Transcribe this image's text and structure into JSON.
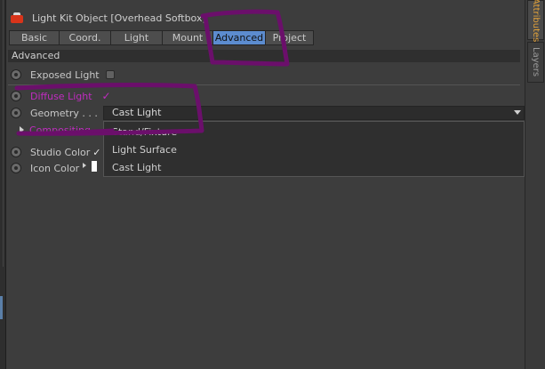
{
  "window": {
    "title": "Light Kit Object [Overhead Softbox]"
  },
  "tabs": [
    {
      "label": "Basic"
    },
    {
      "label": "Coord."
    },
    {
      "label": "Light"
    },
    {
      "label": "Mount"
    },
    {
      "label": "Advanced",
      "active": true
    },
    {
      "label": "Project"
    }
  ],
  "section": {
    "title": "Advanced"
  },
  "fields": {
    "exposed_light": "Exposed Light",
    "diffuse_light": "Diffuse Light",
    "diffuse_check": "✓",
    "geometry_label": "Geometry . . .",
    "geometry_value": "Cast Light",
    "compositing": "Compositing",
    "studio_color": "Studio Color",
    "studio_check": "✓",
    "icon_color": "Icon Color"
  },
  "geometry_options": [
    {
      "label": "Stand/Fixture",
      "highlighted": true
    },
    {
      "label": "Light Surface"
    },
    {
      "label": "Cast Light"
    }
  ],
  "right_tabs": {
    "attributes": "Attributes",
    "layers": "Layers"
  },
  "colors": {
    "active_tab": "#5c8ccf",
    "annotation": "#6b0f6b",
    "magenta_text": "#c02cc0",
    "attributes_tab_text": "#e2a23a"
  }
}
